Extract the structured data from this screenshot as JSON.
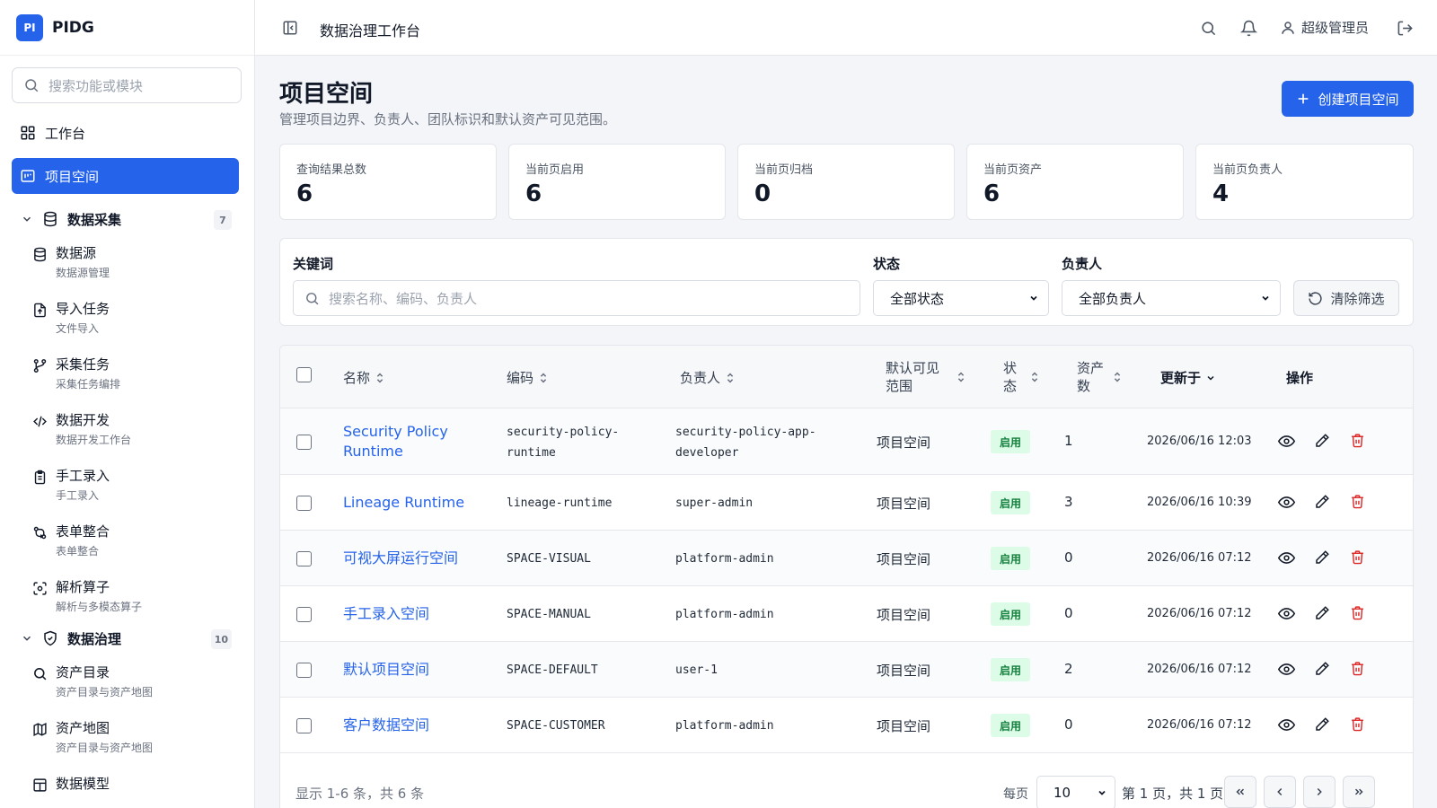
{
  "brand": {
    "logo_text": "PI",
    "name": "PIDG"
  },
  "sidebar": {
    "search_placeholder": "搜索功能或模块",
    "top_items": [
      {
        "label": "工作台",
        "icon": "dashboard-icon"
      },
      {
        "label": "项目空间",
        "icon": "project-space-icon",
        "active": true
      }
    ],
    "groups": [
      {
        "label": "数据采集",
        "count": "7",
        "icon": "database-icon",
        "items": [
          {
            "title": "数据源",
            "subtitle": "数据源管理",
            "icon": "database-icon"
          },
          {
            "title": "导入任务",
            "subtitle": "文件导入",
            "icon": "file-upload-icon"
          },
          {
            "title": "采集任务",
            "subtitle": "采集任务编排",
            "icon": "workflow-icon"
          },
          {
            "title": "数据开发",
            "subtitle": "数据开发工作台",
            "icon": "code-icon"
          },
          {
            "title": "手工录入",
            "subtitle": "手工录入",
            "icon": "clipboard-icon"
          },
          {
            "title": "表单整合",
            "subtitle": "表单整合",
            "icon": "merge-icon"
          },
          {
            "title": "解析算子",
            "subtitle": "解析与多模态算子",
            "icon": "scan-icon"
          }
        ]
      },
      {
        "label": "数据治理",
        "count": "10",
        "icon": "shield-icon",
        "items": [
          {
            "title": "资产目录",
            "subtitle": "资产目录与资产地图",
            "icon": "search-icon"
          },
          {
            "title": "资产地图",
            "subtitle": "资产目录与资产地图",
            "icon": "map-icon"
          },
          {
            "title": "数据模型",
            "subtitle": "",
            "icon": "table-icon"
          }
        ]
      }
    ]
  },
  "header": {
    "title": "数据治理工作台",
    "user": "超级管理员"
  },
  "page": {
    "title": "项目空间",
    "subtitle": "管理项目边界、负责人、团队标识和默认资产可见范围。",
    "create_button": "创建项目空间"
  },
  "stats": [
    {
      "label": "查询结果总数",
      "value": "6"
    },
    {
      "label": "当前页启用",
      "value": "6"
    },
    {
      "label": "当前页归档",
      "value": "0"
    },
    {
      "label": "当前页资产",
      "value": "6"
    },
    {
      "label": "当前页负责人",
      "value": "4"
    }
  ],
  "filters": {
    "keyword_label": "关键词",
    "keyword_placeholder": "搜索名称、编码、负责人",
    "status_label": "状态",
    "status_value": "全部状态",
    "owner_label": "负责人",
    "owner_value": "全部负责人",
    "clear_button": "清除筛选"
  },
  "table": {
    "columns": {
      "name": "名称",
      "code": "编码",
      "owner": "负责人",
      "scope_line1": "默认可见",
      "scope_line2": "范围",
      "status_line1": "状",
      "status_line2": "态",
      "assets_line1": "资产",
      "assets_line2": "数",
      "updated": "更新于",
      "actions": "操作"
    },
    "rows": [
      {
        "name_line1": "Security Policy",
        "name_line2": "Runtime",
        "code_line1": "security-policy-",
        "code_line2": "runtime",
        "owner_line1": "security-policy-app-",
        "owner_line2": "developer",
        "scope": "项目空间",
        "status": "启用",
        "assets": "1",
        "updated": "2026/06/16 12:03"
      },
      {
        "name_line1": "Lineage Runtime",
        "name_line2": "",
        "code_line1": "lineage-runtime",
        "code_line2": "",
        "owner_line1": "super-admin",
        "owner_line2": "",
        "scope": "项目空间",
        "status": "启用",
        "assets": "3",
        "updated": "2026/06/16 10:39"
      },
      {
        "name_line1": "可视大屏运行空间",
        "name_line2": "",
        "code_line1": "SPACE-VISUAL",
        "code_line2": "",
        "owner_line1": "platform-admin",
        "owner_line2": "",
        "scope": "项目空间",
        "status": "启用",
        "assets": "0",
        "updated": "2026/06/16 07:12"
      },
      {
        "name_line1": "手工录入空间",
        "name_line2": "",
        "code_line1": "SPACE-MANUAL",
        "code_line2": "",
        "owner_line1": "platform-admin",
        "owner_line2": "",
        "scope": "项目空间",
        "status": "启用",
        "assets": "0",
        "updated": "2026/06/16 07:12"
      },
      {
        "name_line1": "默认项目空间",
        "name_line2": "",
        "code_line1": "SPACE-DEFAULT",
        "code_line2": "",
        "owner_line1": "user-1",
        "owner_line2": "",
        "scope": "项目空间",
        "status": "启用",
        "assets": "2",
        "updated": "2026/06/16 07:12"
      },
      {
        "name_line1": "客户数据空间",
        "name_line2": "",
        "code_line1": "SPACE-CUSTOMER",
        "code_line2": "",
        "owner_line1": "platform-admin",
        "owner_line2": "",
        "scope": "项目空间",
        "status": "启用",
        "assets": "0",
        "updated": "2026/06/16 07:12"
      }
    ]
  },
  "pagination": {
    "summary": "显示 1-6 条，共 6 条",
    "per_page_label": "每页",
    "per_page_value": "10",
    "page_info": "第 1 页，共 1 页"
  },
  "colors": {
    "accent": "#2563eb",
    "status_ok_bg": "#dcfce7",
    "status_ok_text": "#15803d",
    "danger": "#dc2626"
  }
}
